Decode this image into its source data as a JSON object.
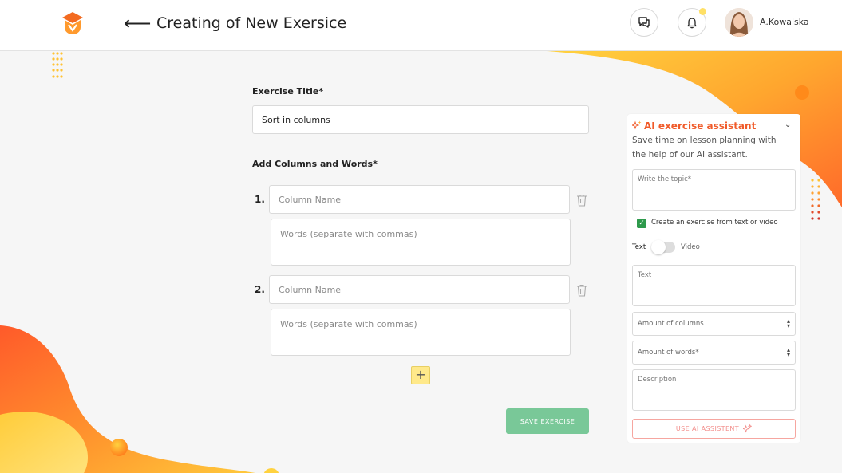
{
  "header": {
    "back_label": "⟵",
    "title": "Creating of New Exersice",
    "user_name": "A.Kowalska",
    "icons": [
      "logo-icon",
      "chat-icon",
      "bell-icon",
      "avatar"
    ]
  },
  "form": {
    "exercise_title_label": "Exercise Title*",
    "exercise_title_value": "Sort in columns",
    "columns_label": "Add Columns and Words*",
    "columns": [
      {
        "number": "1.",
        "name_placeholder": "Column Name",
        "words_placeholder": "Words (separate with commas)"
      },
      {
        "number": "2.",
        "name_placeholder": "Column Name",
        "words_placeholder": "Words (separate with commas)"
      }
    ],
    "add_label": "+",
    "save_label": "SAVE EXERCISE"
  },
  "assistant": {
    "title": "AI exercise assistant",
    "description": "Save time on lesson planning with the help of our AI assistant.",
    "topic_placeholder": "Write the topic*",
    "checkbox_label": "Create an exercise from text or video",
    "checkbox_checked": true,
    "toggle_text": "Text",
    "toggle_video": "Video",
    "text_placeholder": "Text",
    "columns_placeholder": "Amount of columns",
    "words_placeholder": "Amount of words*",
    "description_placeholder": "Description",
    "button_label": "USE AI ASSISTENT"
  },
  "colors": {
    "accent": "#f05b2a",
    "orange": "#ff8a2a",
    "yellow": "#ffd23f",
    "save_green": "#6cc48e",
    "checkbox_green": "#2e9a4c"
  }
}
